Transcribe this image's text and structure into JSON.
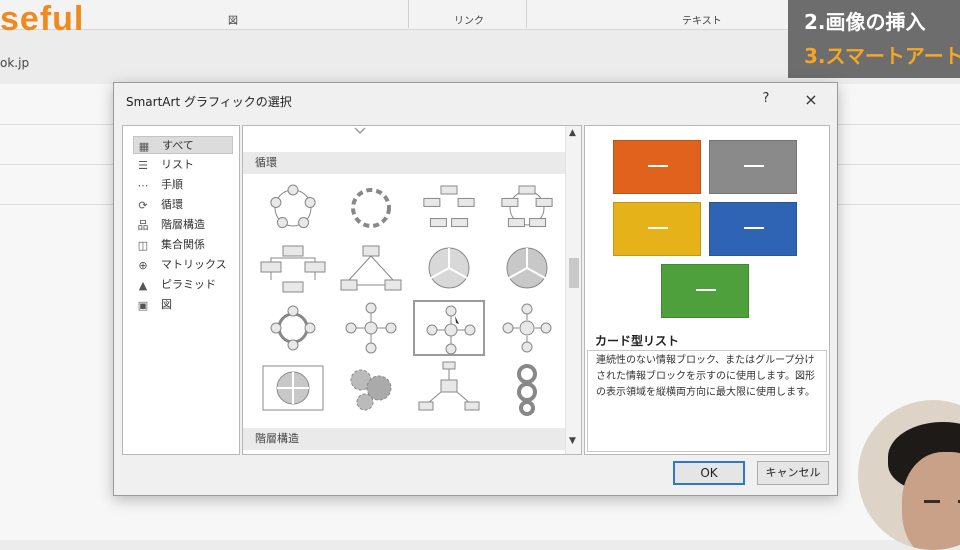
{
  "background": {
    "logo_text": "seful",
    "ribbon_groups": [
      "図",
      "リンク",
      "テキスト"
    ],
    "url_fragment": "ok.jp",
    "overlay_line1": "2.画像の挿入",
    "overlay_line2": "3.スマートアート"
  },
  "dialog": {
    "title": "SmartArt グラフィックの選択",
    "help_label": "?",
    "close_label": "×",
    "categories": [
      {
        "label": "すべて",
        "icon": "all-icon",
        "glyph": "▦",
        "selected": true
      },
      {
        "label": "リスト",
        "icon": "list-icon",
        "glyph": "☰",
        "selected": false
      },
      {
        "label": "手順",
        "icon": "process-icon",
        "glyph": "⋯",
        "selected": false
      },
      {
        "label": "循環",
        "icon": "cycle-icon",
        "glyph": "⟳",
        "selected": false
      },
      {
        "label": "階層構造",
        "icon": "hierarchy-icon",
        "glyph": "品",
        "selected": false
      },
      {
        "label": "集合関係",
        "icon": "relationship-icon",
        "glyph": "◫",
        "selected": false
      },
      {
        "label": "マトリックス",
        "icon": "matrix-icon",
        "glyph": "⊕",
        "selected": false
      },
      {
        "label": "ピラミッド",
        "icon": "pyramid-icon",
        "glyph": "▲",
        "selected": false
      },
      {
        "label": "図",
        "icon": "picture-icon",
        "glyph": "▣",
        "selected": false
      }
    ],
    "gallery": {
      "section_top": "循環",
      "section_bottom": "階層構造",
      "thumbnails": [
        "basic-cycle",
        "text-cycle",
        "block-cycle",
        "nondirectional-cycle",
        "continuous-cycle",
        "multidirectional-cycle",
        "segmented-cycle",
        "basic-pie",
        "circle-arrows",
        "radial-cycle",
        "basic-radial-selected",
        "diverging-radial",
        "gear-matrix",
        "gear",
        "radial-cluster",
        "circular-arrows"
      ],
      "selected_index": 10
    },
    "preview": {
      "card_colors": [
        "#e0621c",
        "#8a8a8a",
        "#e5b21a",
        "#2e64b3",
        "#4ea03c"
      ],
      "layout_name": "カード型リスト",
      "layout_description": "連続性のない情報ブロック、またはグループ分けされた情報ブロックを示すのに使用します。図形の表示領域を縦横両方向に最大限に使用します。"
    },
    "ok_label": "OK",
    "cancel_label": "キャンセル"
  }
}
